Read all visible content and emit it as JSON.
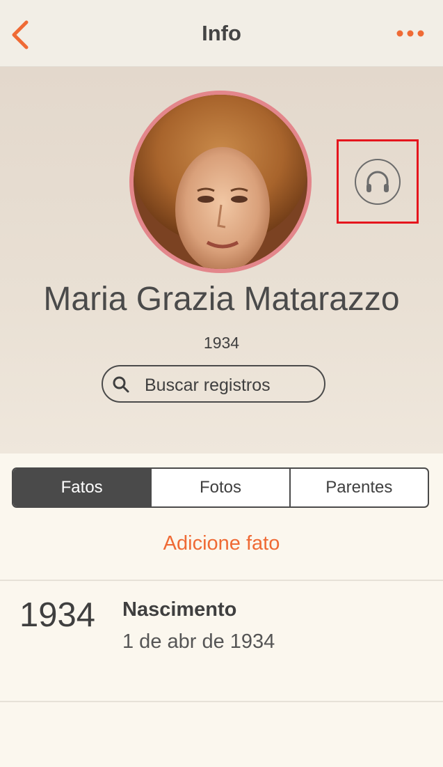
{
  "navbar": {
    "title": "Info",
    "back_icon": "chevron-left-icon",
    "more_icon": "more-horizontal-icon",
    "accent_color": "#ef6a35"
  },
  "profile": {
    "photo": "portrait-photo",
    "name": "Maria Grazia Matarazzo",
    "years": "1934",
    "audio_icon": "headphones-icon",
    "search_label": "Buscar registros",
    "search_icon": "search-icon"
  },
  "tabs": [
    {
      "label": "Fatos",
      "active": true
    },
    {
      "label": "Fotos",
      "active": false
    },
    {
      "label": "Parentes",
      "active": false
    }
  ],
  "facts": {
    "add_label": "Adicione fato",
    "items": [
      {
        "year": "1934",
        "title": "Nascimento",
        "date": "1 de abr de 1934"
      }
    ]
  }
}
